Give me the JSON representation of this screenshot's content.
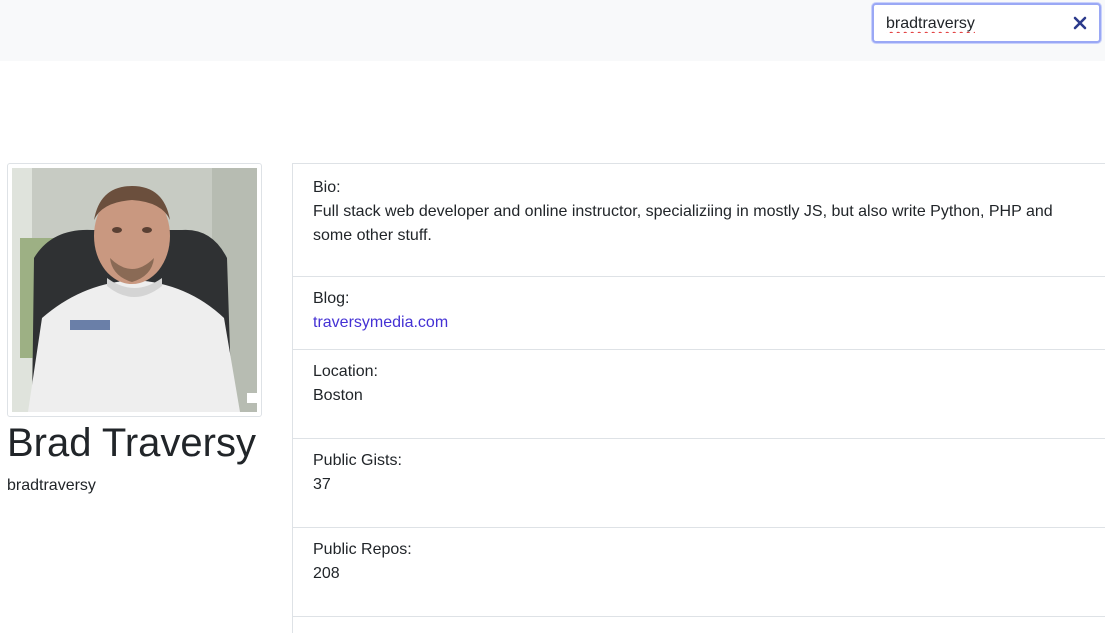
{
  "search": {
    "value": "bradtraversy",
    "clear_icon": "close-icon"
  },
  "profile": {
    "name": "Brad Traversy",
    "login": "bradtraversy"
  },
  "details": {
    "bio_label": "Bio:",
    "bio_line1": "Full stack web developer and online instructor, specializiing in mostly JS, but also write Python, PHP and",
    "bio_line2": "some other stuff.",
    "blog_label": "Blog:",
    "blog_value": "traversymedia.com",
    "location_label": "Location:",
    "location_value": "Boston",
    "gists_label": "Public Gists:",
    "gists_value": "37",
    "repos_label": "Public Repos:",
    "repos_value": "208"
  },
  "colors": {
    "topbar_bg": "#f8f9fa",
    "search_focus_border": "#9aa8f5",
    "link": "#4431d4",
    "clear_icon": "#2b3a8c"
  }
}
